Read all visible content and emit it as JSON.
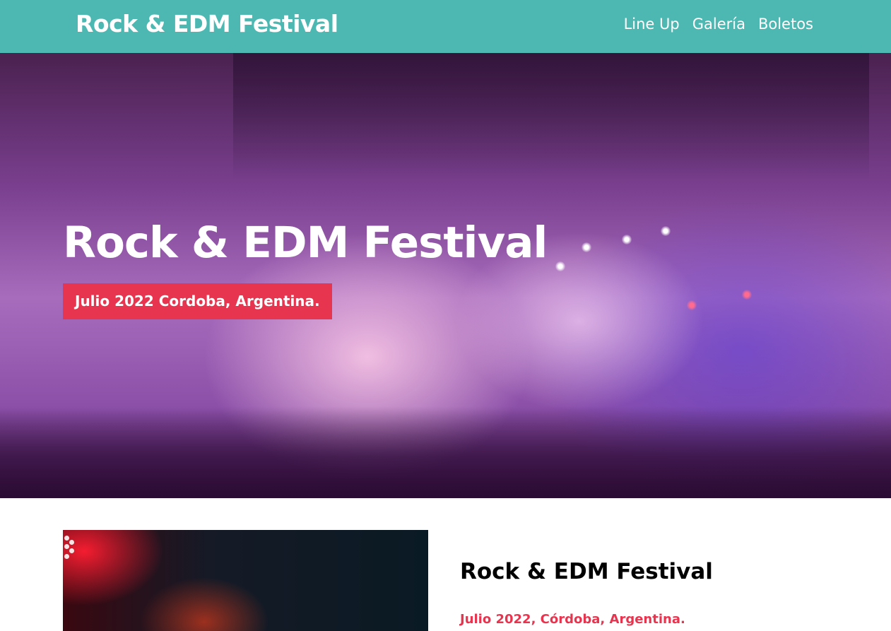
{
  "header": {
    "brand": "Rock & EDM Festival",
    "nav": [
      {
        "label": "Line Up"
      },
      {
        "label": "Galería"
      },
      {
        "label": "Boletos"
      }
    ],
    "background_color": "#4db8b2"
  },
  "hero": {
    "title": "Rock & EDM Festival",
    "badge": "Julio 2022 Cordoba, Argentina.",
    "badge_color": "#e8354f",
    "image_icon": "concert-photo"
  },
  "feature": {
    "image_icon": "performer-photo",
    "title": "Rock & EDM Festival",
    "subtitle": "Julio 2022, Córdoba, Argentina.",
    "subtitle_color": "#e8354f"
  }
}
